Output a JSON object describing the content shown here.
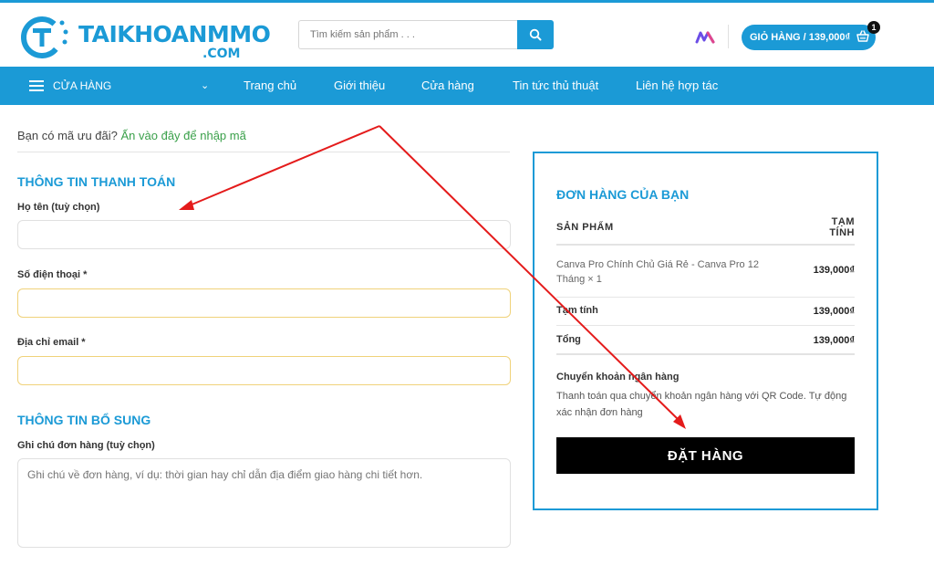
{
  "header": {
    "logo_text": "TAIKHOANMMO",
    "logo_sub": ".COM",
    "search_placeholder": "Tìm kiếm sản phẩm . . .",
    "cart_label": "GIỎ HÀNG / 139,000₫",
    "cart_count": "1"
  },
  "nav": {
    "menu_label": "CỬA HÀNG",
    "items": [
      "Trang chủ",
      "Giới thiệu",
      "Cửa hàng",
      "Tin tức thủ thuật",
      "Liên hệ hợp tác"
    ]
  },
  "coupon": {
    "question": "Bạn có mã ưu đãi?",
    "link": "Ấn vào đây để nhập mã"
  },
  "billing": {
    "title": "THÔNG TIN THANH TOÁN",
    "name_label": "Họ tên (tuỳ chọn)",
    "name_value": "",
    "phone_label": "Số điện thoại *",
    "phone_value": "",
    "email_label": "Địa chỉ email *",
    "email_value": ""
  },
  "additional": {
    "title": "THÔNG TIN BỔ SUNG",
    "notes_label": "Ghi chú đơn hàng (tuỳ chọn)",
    "notes_placeholder": "Ghi chú về đơn hàng, ví dụ: thời gian hay chỉ dẫn địa điểm giao hàng chi tiết hơn."
  },
  "order": {
    "title": "ĐƠN HÀNG CỦA BẠN",
    "col_product": "SẢN PHẨM",
    "col_subtotal": "TẠM TÍNH",
    "product_name": "Canva Pro Chính Chủ Giá Rẻ - Canva Pro 12 Tháng  × 1",
    "product_amount": "139,000₫",
    "subtotal_label": "Tạm tính",
    "subtotal_amount": "139,000₫",
    "total_label": "Tổng",
    "total_amount": "139,000₫",
    "payment_title": "Chuyển khoản ngân hàng",
    "payment_desc": "Thanh toán qua chuyển khoản ngân hàng với QR Code. Tự động xác nhận đơn hàng",
    "place_order": "ĐẶT HÀNG"
  },
  "colors": {
    "brand": "#1b9ad6",
    "coupon_link": "#3aa04a",
    "annotation_arrow": "#e41b1b",
    "place_order_bg": "#000000"
  }
}
